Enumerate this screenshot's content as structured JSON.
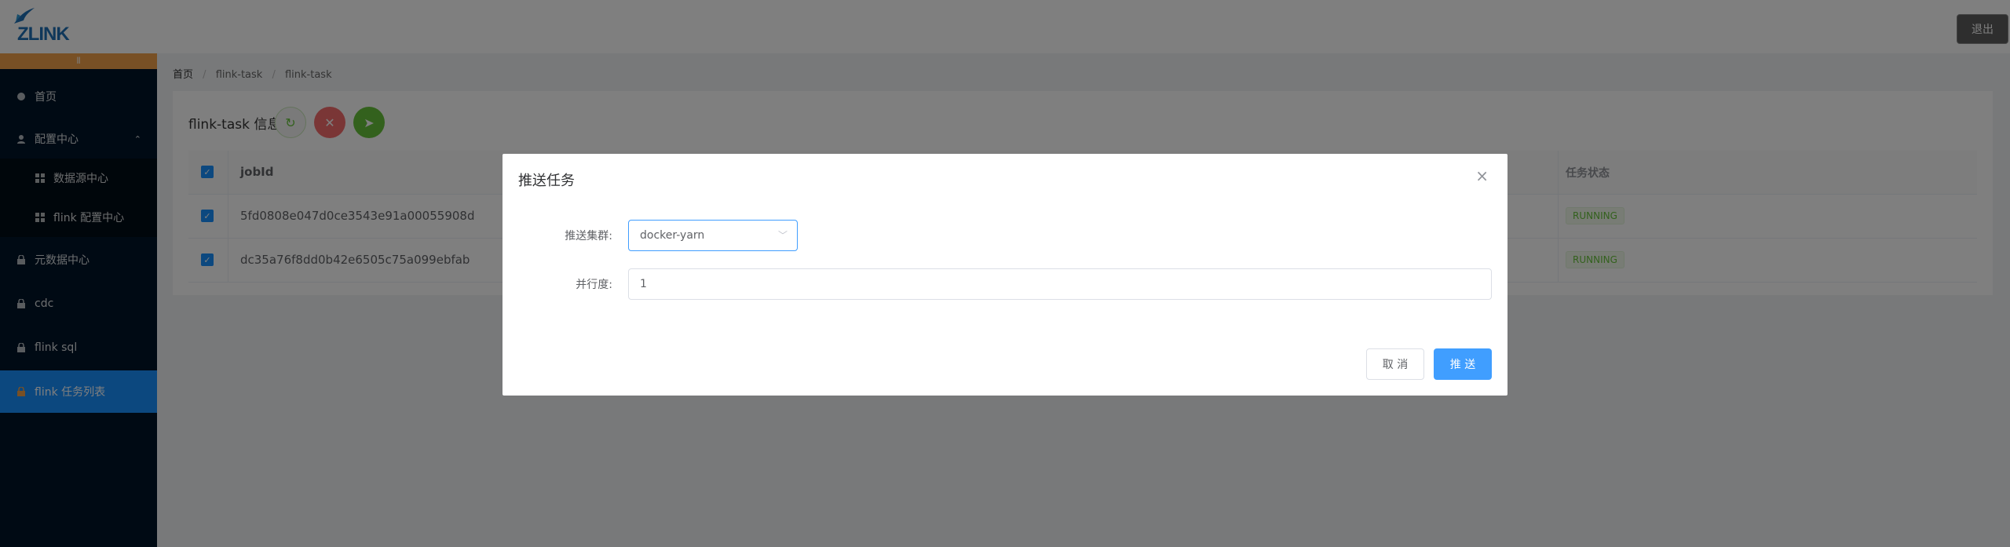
{
  "header": {
    "logo_text": "ZLINK",
    "logout_label": "退出"
  },
  "sidebar": {
    "toggle_icon": "menu-toggle-icon",
    "items": [
      {
        "label": "首页",
        "icon": "home-icon"
      },
      {
        "label": "配置中心",
        "icon": "user-icon",
        "expanded": true
      },
      {
        "label": "数据源中心",
        "icon": "grid-icon"
      },
      {
        "label": "flink 配置中心",
        "icon": "grid-icon"
      },
      {
        "label": "元数据中心",
        "icon": "lock-icon"
      },
      {
        "label": "cdc",
        "icon": "lock-icon"
      },
      {
        "label": "flink sql",
        "icon": "lock-icon"
      },
      {
        "label": "flink 任务列表",
        "icon": "lock-icon",
        "active": true
      }
    ]
  },
  "breadcrumb": [
    "首页",
    "flink-task",
    "flink-task"
  ],
  "card": {
    "title": "flink-task 信息"
  },
  "table": {
    "columns": {
      "jobid": "jobId",
      "status": "任务状态"
    },
    "rows": [
      {
        "jobid": "5fd0808e047d0ce3543e91a00055908d",
        "status": "RUNNING",
        "checked": true
      },
      {
        "jobid": "dc35a76f8dd0b42e6505c75a099ebfab",
        "status": "RUNNING",
        "checked": true
      }
    ]
  },
  "modal": {
    "title": "推送任务",
    "cluster_label": "推送集群:",
    "cluster_value": "docker-yarn",
    "parallelism_label": "并行度:",
    "parallelism_value": "1",
    "cancel_label": "取 消",
    "submit_label": "推 送"
  },
  "colors": {
    "sidebar_bg": "#001529",
    "primary": "#409eff",
    "success": "#67c23a",
    "danger": "#f56c6c",
    "accent_orange": "#f0a14a"
  }
}
